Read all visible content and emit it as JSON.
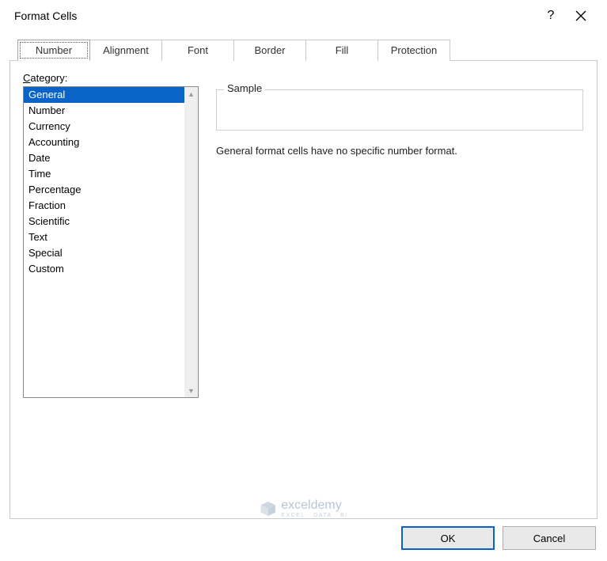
{
  "title": "Format Cells",
  "tabs": [
    {
      "label": "Number",
      "active": true
    },
    {
      "label": "Alignment",
      "active": false
    },
    {
      "label": "Font",
      "active": false
    },
    {
      "label": "Border",
      "active": false
    },
    {
      "label": "Fill",
      "active": false
    },
    {
      "label": "Protection",
      "active": false
    }
  ],
  "category_label_prefix": "C",
  "category_label_rest": "ategory:",
  "categories": [
    "General",
    "Number",
    "Currency",
    "Accounting",
    "Date",
    "Time",
    "Percentage",
    "Fraction",
    "Scientific",
    "Text",
    "Special",
    "Custom"
  ],
  "selected_category_index": 0,
  "sample_label": "Sample",
  "description": "General format cells have no specific number format.",
  "buttons": {
    "ok": "OK",
    "cancel": "Cancel"
  },
  "watermark": {
    "brand": "exceldemy",
    "tagline": "EXCEL · DATA · BI"
  }
}
